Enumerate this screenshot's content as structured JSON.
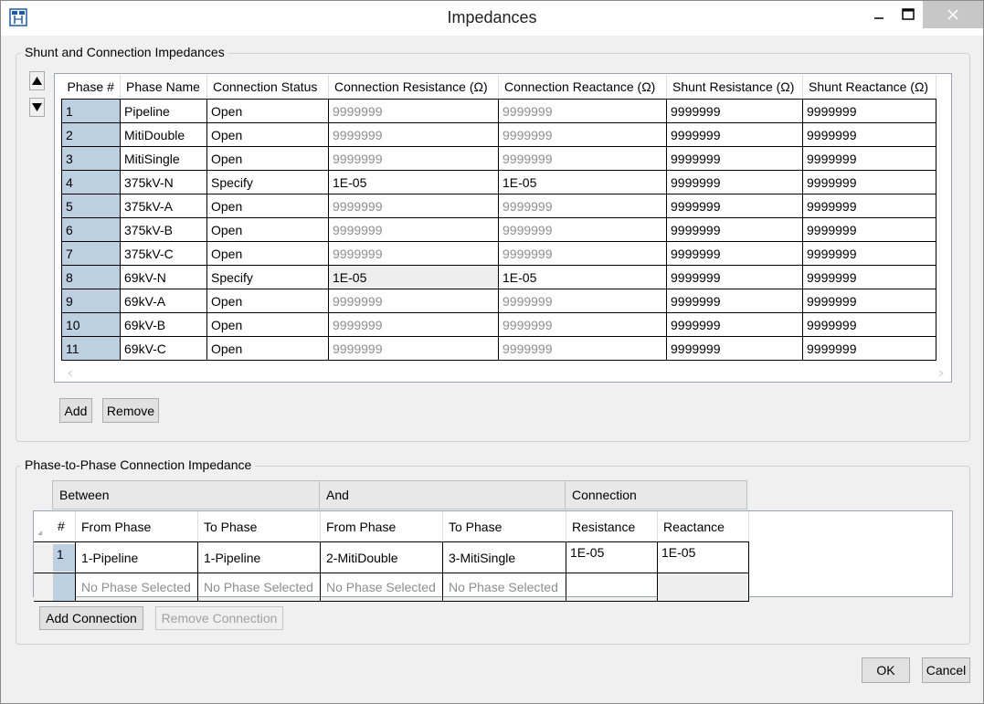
{
  "window": {
    "title": "Impedances",
    "app_icon": "impedance-app-icon",
    "minimize_icon": "minimize-icon",
    "maximize_icon": "maximize-icon",
    "close_icon": "close-icon"
  },
  "shunt_group": {
    "title": "Shunt and Connection Impedances",
    "move_up_icon": "triangle-up-icon",
    "move_down_icon": "triangle-down-icon",
    "columns": [
      "Phase #",
      "Phase Name",
      "Connection Status",
      "Connection Resistance (Ω)",
      "Connection Reactance (Ω)",
      "Shunt Resistance (Ω)",
      "Shunt Reactance (Ω)"
    ],
    "rows": [
      {
        "num": "1",
        "name": "Pipeline",
        "status": "Open",
        "conn_res": "9999999",
        "conn_react": "9999999",
        "shunt_res": "9999999",
        "shunt_react": "9999999"
      },
      {
        "num": "2",
        "name": "MitiDouble",
        "status": "Open",
        "conn_res": "9999999",
        "conn_react": "9999999",
        "shunt_res": "9999999",
        "shunt_react": "9999999"
      },
      {
        "num": "3",
        "name": "MitiSingle",
        "status": "Open",
        "conn_res": "9999999",
        "conn_react": "9999999",
        "shunt_res": "9999999",
        "shunt_react": "9999999"
      },
      {
        "num": "4",
        "name": "375kV-N",
        "status": "Specify",
        "conn_res": "1E-05",
        "conn_react": "1E-05",
        "shunt_res": "9999999",
        "shunt_react": "9999999"
      },
      {
        "num": "5",
        "name": "375kV-A",
        "status": "Open",
        "conn_res": "9999999",
        "conn_react": "9999999",
        "shunt_res": "9999999",
        "shunt_react": "9999999"
      },
      {
        "num": "6",
        "name": "375kV-B",
        "status": "Open",
        "conn_res": "9999999",
        "conn_react": "9999999",
        "shunt_res": "9999999",
        "shunt_react": "9999999"
      },
      {
        "num": "7",
        "name": "375kV-C",
        "status": "Open",
        "conn_res": "9999999",
        "conn_react": "9999999",
        "shunt_res": "9999999",
        "shunt_react": "9999999"
      },
      {
        "num": "8",
        "name": "69kV-N",
        "status": "Specify",
        "conn_res": "1E-05",
        "conn_react": "1E-05",
        "shunt_res": "9999999",
        "shunt_react": "9999999"
      },
      {
        "num": "9",
        "name": "69kV-A",
        "status": "Open",
        "conn_res": "9999999",
        "conn_react": "9999999",
        "shunt_res": "9999999",
        "shunt_react": "9999999"
      },
      {
        "num": "10",
        "name": "69kV-B",
        "status": "Open",
        "conn_res": "9999999",
        "conn_react": "9999999",
        "shunt_res": "9999999",
        "shunt_react": "9999999"
      },
      {
        "num": "11",
        "name": "69kV-C",
        "status": "Open",
        "conn_res": "9999999",
        "conn_react": "9999999",
        "shunt_res": "9999999",
        "shunt_react": "9999999"
      }
    ],
    "add_label": "Add",
    "remove_label": "Remove"
  },
  "phase_group": {
    "title": "Phase-to-Phase Connection Impedance",
    "band_headers": [
      "Between",
      "And",
      "Connection"
    ],
    "columns": [
      "#",
      "From Phase",
      "To Phase",
      "From Phase",
      "To Phase",
      "Resistance",
      "Reactance"
    ],
    "rows": [
      {
        "num": "1",
        "from1": "1-Pipeline",
        "to1": "1-Pipeline",
        "from2": "2-MitiDouble",
        "to2": "3-MitiSingle",
        "res": "1E-05",
        "react": "1E-05"
      }
    ],
    "new_row": {
      "from1": "No Phase Selected",
      "to1": "No Phase Selected",
      "from2": "No Phase Selected",
      "to2": "No Phase Selected"
    },
    "add_connection_label": "Add Connection",
    "remove_connection_label": "Remove Connection"
  },
  "footer": {
    "ok_label": "OK",
    "cancel_label": "Cancel"
  }
}
